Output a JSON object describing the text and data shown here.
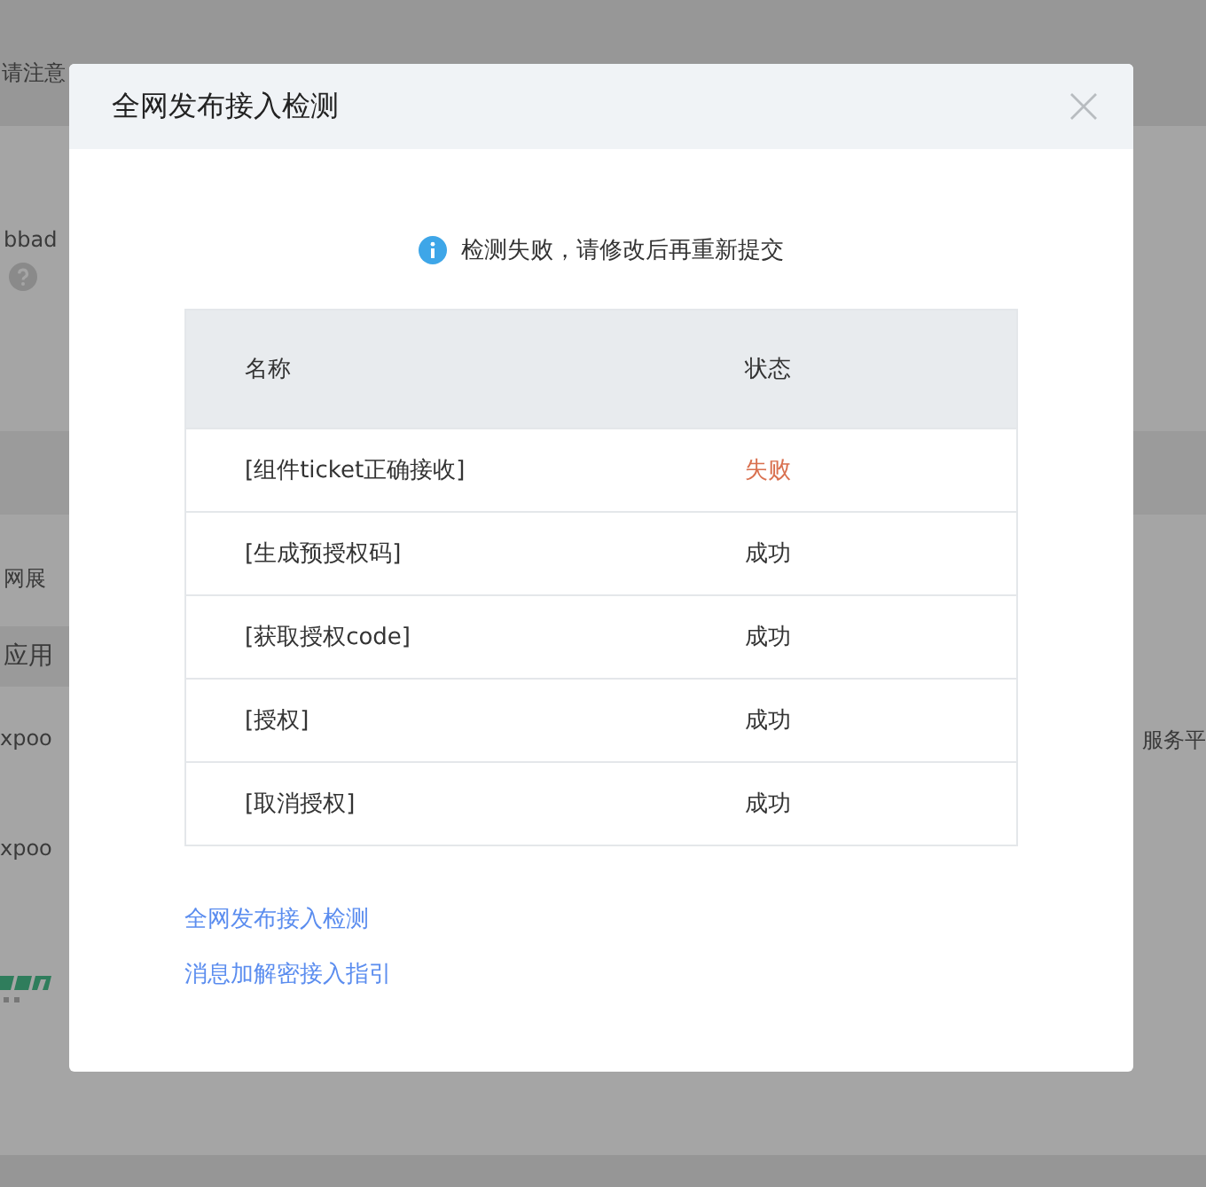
{
  "background": {
    "notice": "请注意",
    "app_id": "bbad",
    "menu_item": "网展",
    "menu_item_active": "应用",
    "row_1_left": "xpoo",
    "row_1_right": "服务平",
    "row_2_left": "xpoo"
  },
  "dialog": {
    "title": "全网发布接入检测",
    "message": "检测失败，请修改后再重新提交",
    "table": {
      "columns": [
        "名称",
        "状态"
      ],
      "rows": [
        {
          "name": "[组件ticket正确接收]",
          "status": "失败",
          "ok": false
        },
        {
          "name": "[生成预授权码]",
          "status": "成功",
          "ok": true
        },
        {
          "name": "[获取授权code]",
          "status": "成功",
          "ok": true
        },
        {
          "name": "[授权]",
          "status": "成功",
          "ok": true
        },
        {
          "name": "[取消授权]",
          "status": "成功",
          "ok": true
        }
      ]
    },
    "links": [
      "全网发布接入检测",
      "消息加解密接入指引"
    ]
  }
}
